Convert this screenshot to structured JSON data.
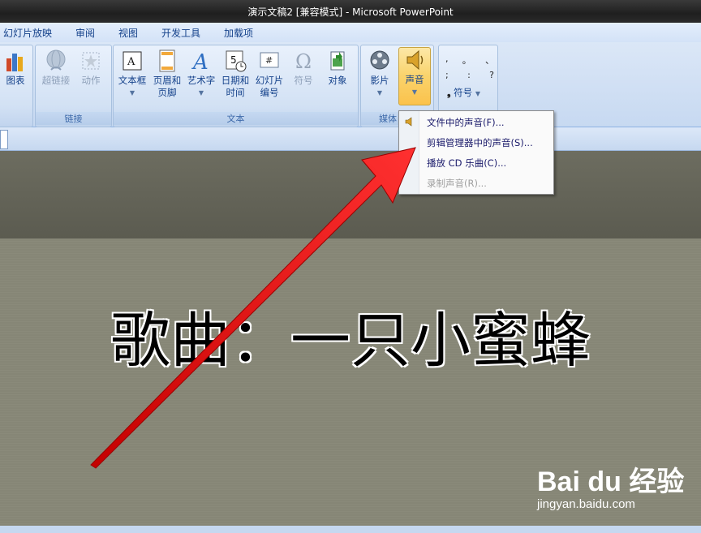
{
  "window": {
    "title": "演示文稿2 [兼容模式] - Microsoft PowerPoint"
  },
  "menu": [
    "幻灯片放映",
    "审阅",
    "视图",
    "开发工具",
    "加载项"
  ],
  "ribbon": {
    "chart_label": "图表",
    "link_group": {
      "label": "链接",
      "hyperlink": "超链接",
      "action": "动作"
    },
    "text_group": {
      "label": "文本",
      "textbox": "文本框",
      "header_footer": [
        "页眉和",
        "页脚"
      ],
      "wordart": "艺术字",
      "datetime": [
        "日期和",
        "时间"
      ],
      "slide_number": [
        "幻灯片",
        "编号"
      ],
      "symbol": "符号",
      "object": "对象"
    },
    "media_group": {
      "label": "媒体",
      "movie": "影片",
      "sound": "声音"
    },
    "symbols_group": {
      "marks_row1": [
        ",",
        "。",
        "、"
      ],
      "marks_row2": [
        ";",
        ":",
        "?"
      ],
      "symbol_label": "符号"
    }
  },
  "sound_menu": {
    "items": [
      {
        "label": "文件中的声音(F)...",
        "enabled": true
      },
      {
        "label": "剪辑管理器中的声音(S)...",
        "enabled": true
      },
      {
        "label": "播放 CD 乐曲(C)...",
        "enabled": true
      },
      {
        "label": "录制声音(R)...",
        "enabled": false
      }
    ]
  },
  "slide": {
    "title": "歌曲：一只小蜜蜂"
  },
  "watermark": {
    "logo": "Bai du 经验",
    "url": "jingyan.baidu.com"
  },
  "colors": {
    "arrow": "#ff1a1a",
    "slide_bg": "#868676",
    "ribbon_text": "#15428b"
  }
}
